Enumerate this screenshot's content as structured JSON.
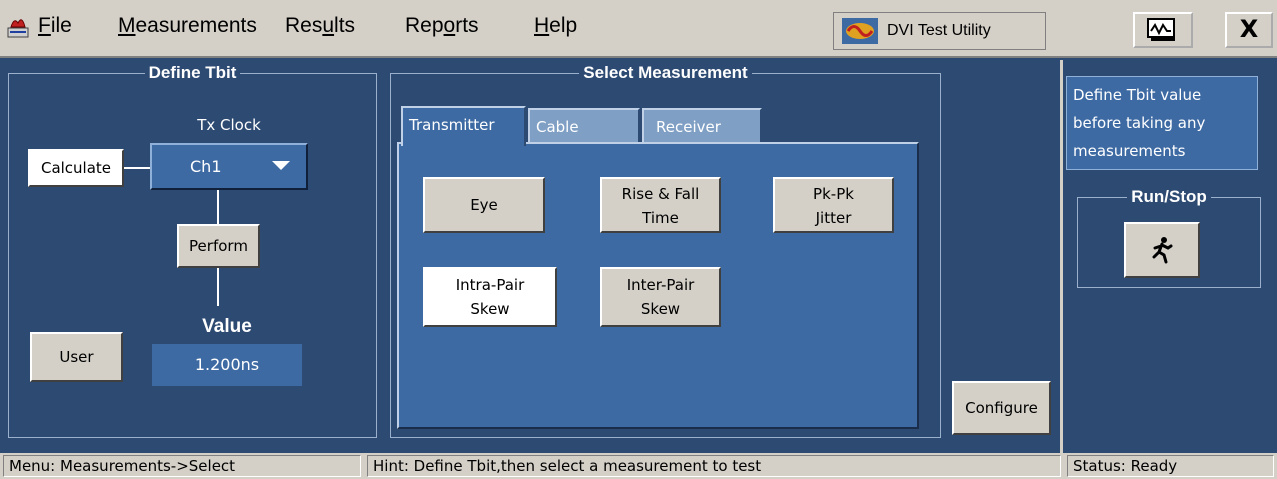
{
  "menu": {
    "items": [
      {
        "label": "File"
      },
      {
        "label": "Measurements"
      },
      {
        "label": "Results"
      },
      {
        "label": "Reports"
      },
      {
        "label": "Help"
      }
    ],
    "app_title": "DVI Test Utility",
    "close_label": "X"
  },
  "define_tbit": {
    "title": "Define Tbit",
    "tx_clock_label": "Tx Clock",
    "calculate_label": "Calculate",
    "channel_value": "Ch1",
    "perform_label": "Perform",
    "value_label": "Value",
    "value": "1.200ns",
    "user_label": "User"
  },
  "select_measurement": {
    "title": "Select Measurement",
    "tabs": [
      {
        "label": "Transmitter"
      },
      {
        "label": "Cable"
      },
      {
        "label": "Receiver"
      }
    ],
    "buttons": {
      "eye": "Eye",
      "rise_fall_1": "Rise & Fall",
      "rise_fall_2": "Time",
      "pkpk_1": "Pk-Pk",
      "pkpk_2": "Jitter",
      "intra_1": "Intra-Pair",
      "intra_2": "Skew",
      "inter_1": "Inter-Pair",
      "inter_2": "Skew"
    },
    "configure_label": "Configure"
  },
  "side": {
    "hint_lines": [
      "Define Tbit value",
      "before taking any",
      "measurements"
    ],
    "run_stop_title": "Run/Stop"
  },
  "status": {
    "menu": "Menu: Measurements->Select",
    "hint": "Hint: Define Tbit,then select a measurement to test",
    "status": "Status: Ready"
  },
  "colors": {
    "background": "#2d4a72",
    "panel_fill": "#3e6aa3",
    "chrome": "#d4d0c8"
  }
}
